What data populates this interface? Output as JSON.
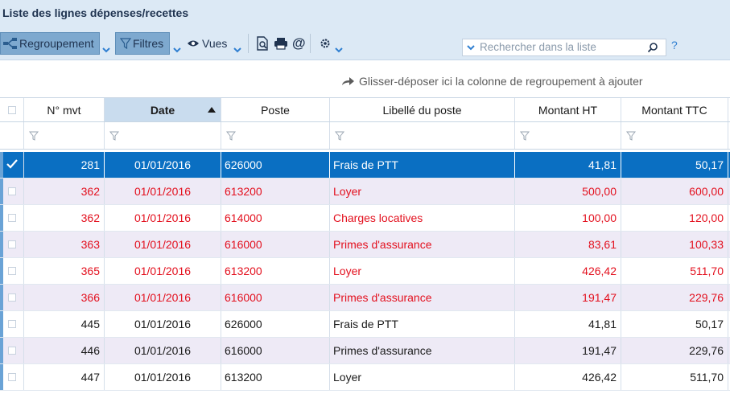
{
  "window": {
    "title": "Liste des lignes dépenses/recettes"
  },
  "toolbar": {
    "grouping_label": "Regroupement",
    "filters_label": "Filtres",
    "views_label": "Vues",
    "search_placeholder": "Rechercher dans la liste",
    "help_label": "?"
  },
  "group_hint": "Glisser-déposer ici la colonne de regroupement à ajouter",
  "colors": {
    "accent": "#0a6fc2",
    "toolbar_bg": "#dce9f5",
    "alt_row": "#eeeaf6",
    "red_text": "#e3101e"
  },
  "table": {
    "columns": [
      "N° mvt",
      "Date",
      "Poste",
      "Libellé du poste",
      "Montant HT",
      "Montant TTC"
    ],
    "sorted_column": "Date",
    "rows": [
      {
        "mvt": "281",
        "date": "01/01/2016",
        "poste": "626000",
        "libelle": "Frais de PTT",
        "ht": "41,81",
        "ttc": "50,17",
        "selected": true,
        "red": false
      },
      {
        "mvt": "362",
        "date": "01/01/2016",
        "poste": "613200",
        "libelle": "Loyer",
        "ht": "500,00",
        "ttc": "600,00",
        "selected": false,
        "red": true
      },
      {
        "mvt": "362",
        "date": "01/01/2016",
        "poste": "614000",
        "libelle": "Charges locatives",
        "ht": "100,00",
        "ttc": "120,00",
        "selected": false,
        "red": true
      },
      {
        "mvt": "363",
        "date": "01/01/2016",
        "poste": "616000",
        "libelle": "Primes d'assurance",
        "ht": "83,61",
        "ttc": "100,33",
        "selected": false,
        "red": true
      },
      {
        "mvt": "365",
        "date": "01/01/2016",
        "poste": "613200",
        "libelle": "Loyer",
        "ht": "426,42",
        "ttc": "511,70",
        "selected": false,
        "red": true
      },
      {
        "mvt": "366",
        "date": "01/01/2016",
        "poste": "616000",
        "libelle": "Primes d'assurance",
        "ht": "191,47",
        "ttc": "229,76",
        "selected": false,
        "red": true
      },
      {
        "mvt": "445",
        "date": "01/01/2016",
        "poste": "626000",
        "libelle": "Frais de PTT",
        "ht": "41,81",
        "ttc": "50,17",
        "selected": false,
        "red": false
      },
      {
        "mvt": "446",
        "date": "01/01/2016",
        "poste": "616000",
        "libelle": "Primes d'assurance",
        "ht": "191,47",
        "ttc": "229,76",
        "selected": false,
        "red": false
      },
      {
        "mvt": "447",
        "date": "01/01/2016",
        "poste": "613200",
        "libelle": "Loyer",
        "ht": "426,42",
        "ttc": "511,70",
        "selected": false,
        "red": false
      }
    ]
  }
}
